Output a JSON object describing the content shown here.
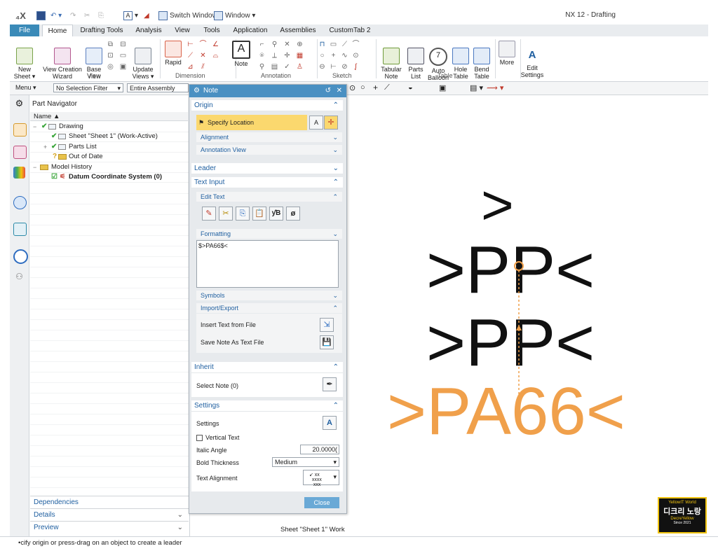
{
  "qat": {
    "switch_window": "Switch Window",
    "window_menu": "Window ▾",
    "app_title": "NX 12 - Drafting"
  },
  "tabs": [
    "File",
    "Home",
    "Drafting Tools",
    "Analysis",
    "View",
    "Tools",
    "Application",
    "Assemblies",
    "CustomTab 2"
  ],
  "ribbon": {
    "buttons": {
      "new_sheet": "New\nSheet ▾",
      "view_creation": "View Creation\nWizard",
      "base_view": "Base\nView",
      "update_views": "Update\nViews ▾",
      "rapid": "Rapid",
      "note": "Note",
      "tabular_note": "Tabular\nNote",
      "parts_list": "Parts\nList",
      "auto_balloon": "Auto\nBalloon",
      "hole_table": "Hole\nTable",
      "bend_table": "Bend\nTable",
      "more": "More",
      "edit_settings": "Edit\nSettings"
    },
    "groups": {
      "view": "View",
      "dimension": "Dimension",
      "annotation": "Annotation",
      "sketch": "Sketch",
      "table": "Table"
    }
  },
  "toolbar": {
    "menu": "Menu ▾",
    "selection_filter": "No Selection Filter",
    "assembly_scope": "Entire Assembly"
  },
  "navigator": {
    "title": "Part Navigator",
    "column": "Name",
    "rows": [
      {
        "label": "Drawing",
        "indent": 1
      },
      {
        "label": "Sheet \"Sheet 1\" (Work-Active)",
        "indent": 2
      },
      {
        "label": "Parts List",
        "indent": 2
      },
      {
        "label": "Out of Date",
        "indent": 2
      },
      {
        "label": "Model History",
        "indent": 1
      },
      {
        "label": "Datum Coordinate System (0)",
        "indent": 2
      }
    ],
    "footer": [
      "Dependencies",
      "Details",
      "Preview"
    ]
  },
  "note_dialog": {
    "title": "Note",
    "sections": {
      "origin": "Origin",
      "specify_location": "Specify Location",
      "alignment": "Alignment",
      "annotation_view": "Annotation View",
      "leader": "Leader",
      "text_input": "Text Input",
      "edit_text": "Edit Text",
      "formatting": "Formatting",
      "symbols": "Symbols",
      "import_export": "Import/Export",
      "insert_text": "Insert Text from File",
      "save_note": "Save Note As Text File",
      "inherit": "Inherit",
      "select_note": "Select Note (0)",
      "settings": "Settings",
      "settings_label": "Settings",
      "vertical_text": "Vertical Text",
      "italic_angle": "Italic Angle",
      "bold_thickness": "Bold Thickness",
      "text_alignment": "Text Alignment"
    },
    "text_value": "$>PA66$<",
    "italic_angle_value": "20.0000(",
    "bold_thickness_value": "Medium",
    "close_label": "Close"
  },
  "graphics": {
    "line1": ">",
    "line2": ">PP<",
    "line3": ">PP<",
    "preview": ">PA66<",
    "preview_color": "#f0a04b",
    "sheet_label": "Sheet \"Sheet 1\" Work"
  },
  "status": "•cify origin or press-drag on an object to create a leader",
  "watermark": {
    "top": "YellowIT World",
    "mid": "디크리 노랑",
    "sub": "DecreYellow",
    "since": "Since 2021"
  }
}
